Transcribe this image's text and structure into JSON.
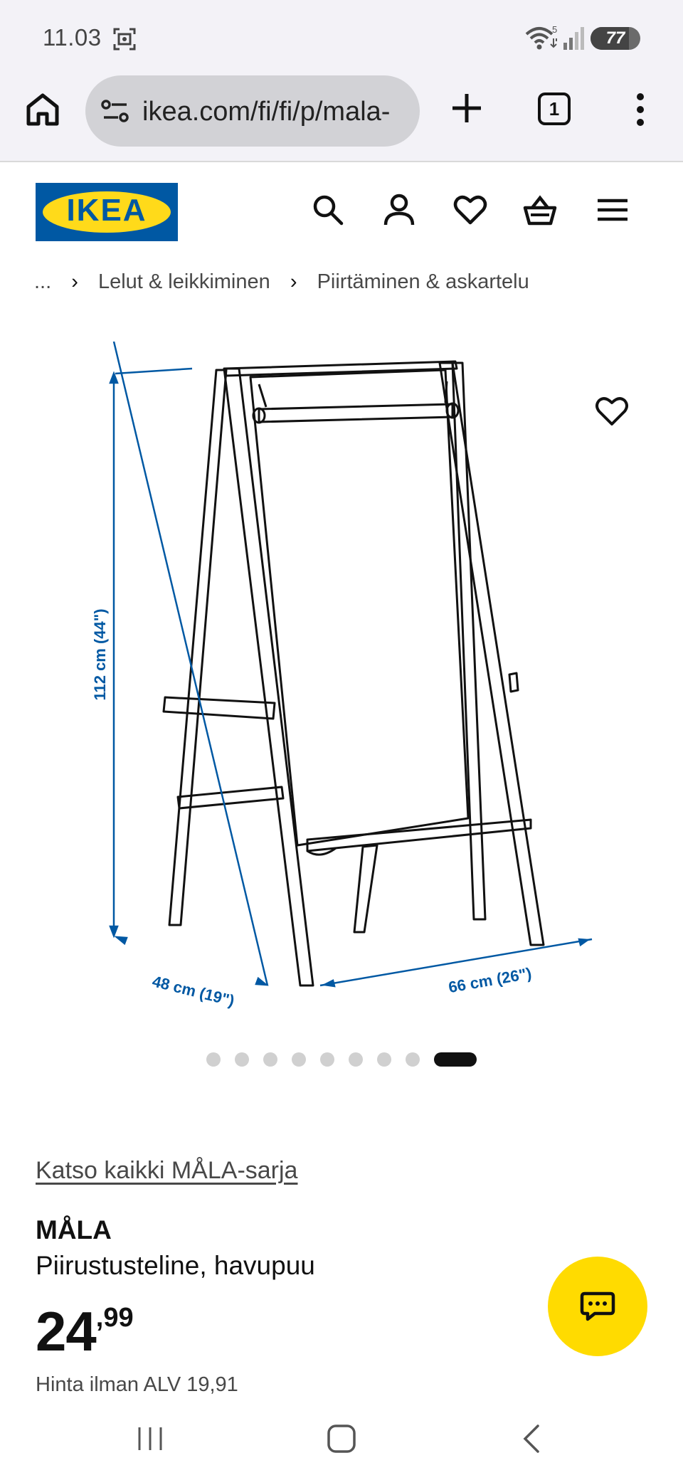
{
  "status_bar": {
    "time": "11.03",
    "battery": "77",
    "battery_level": 0.77,
    "wifi_badge": "5",
    "icons": [
      "screenshot-icon",
      "wifi-icon",
      "signal-icon",
      "battery-icon"
    ]
  },
  "browser": {
    "url": "ikea.com/fi/fi/p/mala-",
    "tab_count": "1",
    "icons": [
      "home-icon",
      "site-info-icon",
      "new-tab-icon",
      "tabs-icon",
      "menu-icon"
    ]
  },
  "header": {
    "logo_text": "IKEA",
    "colors": {
      "blue": "#0058a3",
      "yellow": "#ffda1a"
    },
    "icons": [
      "search-icon",
      "account-icon",
      "wishlist-icon",
      "cart-icon",
      "hamburger-icon"
    ]
  },
  "breadcrumb": {
    "ellipsis": "...",
    "items": [
      "Lelut & leikkiminen",
      "Piirtäminen & askartelu"
    ]
  },
  "gallery": {
    "dimensions": {
      "height": "112 cm (44\")",
      "depth": "48 cm (19\")",
      "width": "66 cm (26\")"
    },
    "dot_count": 9,
    "active_index": 8,
    "dimension_color": "#0058a3"
  },
  "product": {
    "series_link": "Katso kaikki MÅLA-sarja",
    "name": "MÅLA",
    "description": "Piirustusteline, havupuu",
    "price_int": "24",
    "price_dec": ",99",
    "price_note": "Hinta ilman ALV 19,91"
  },
  "chat": {
    "icon": "chat-icon",
    "color": "#ffdb00"
  },
  "system_nav": {
    "icons": [
      "recents-icon",
      "home-button-icon",
      "back-icon"
    ]
  }
}
